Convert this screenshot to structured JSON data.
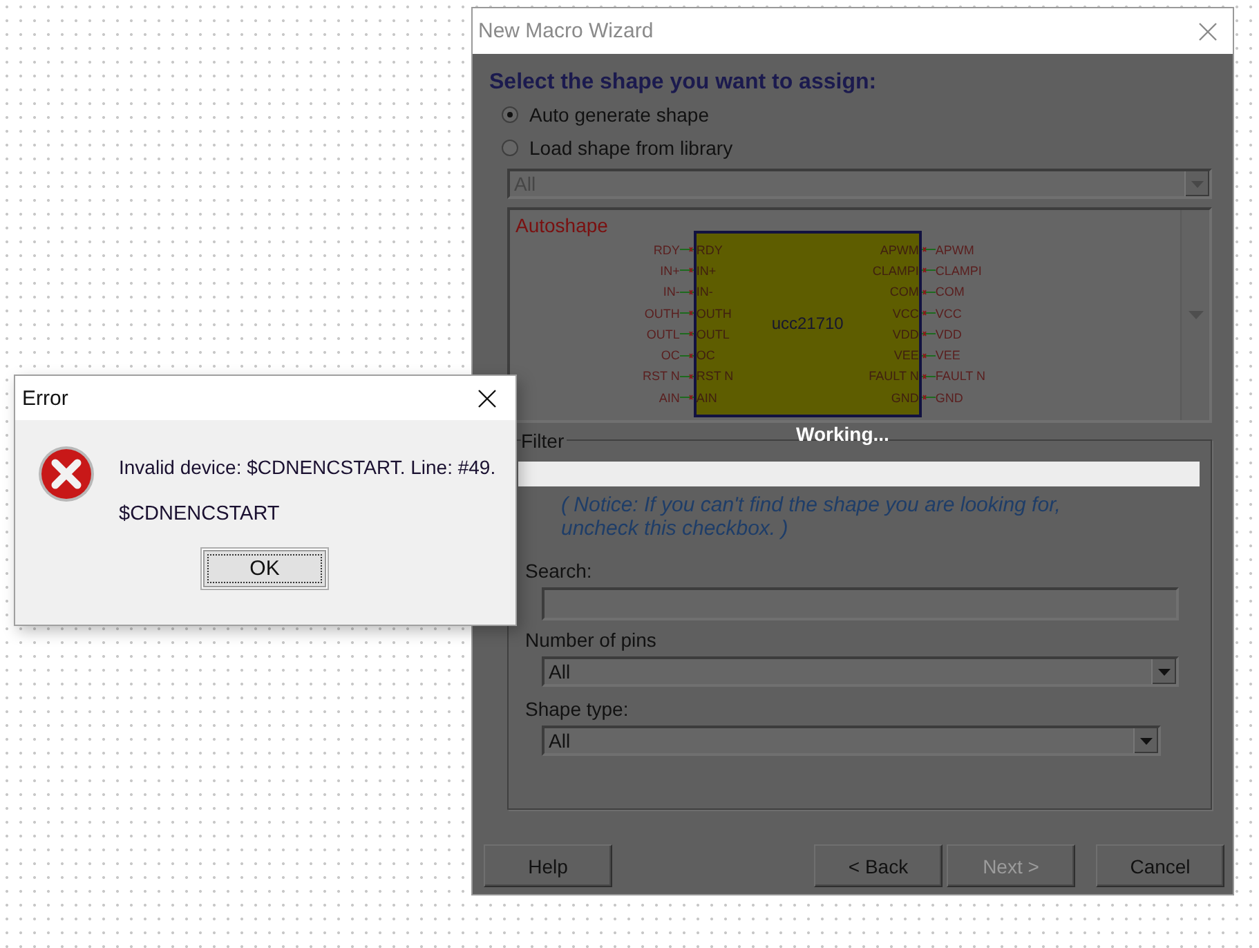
{
  "wizard": {
    "title": "New Macro Wizard",
    "heading": "Select the shape you want to assign:",
    "shape_source": [
      {
        "label": "Auto generate shape",
        "selected": true
      },
      {
        "label": "Load shape from library",
        "selected": false
      }
    ],
    "library": {
      "value": "All",
      "disabled": true
    },
    "preview": {
      "title": "Autoshape",
      "part": "ucc21710",
      "left_pins": [
        {
          "outer": "RDY",
          "inner": "RDY"
        },
        {
          "outer": "IN+",
          "inner": "IN+"
        },
        {
          "outer": "IN-",
          "inner": "IN-"
        },
        {
          "outer": "OUTH",
          "inner": "OUTH"
        },
        {
          "outer": "OUTL",
          "inner": "OUTL"
        },
        {
          "outer": "OC",
          "inner": "OC"
        },
        {
          "outer": "RST N",
          "inner": "RST N"
        },
        {
          "outer": "AIN",
          "inner": "AIN"
        }
      ],
      "right_pins": [
        {
          "inner": "APWM",
          "outer": "APWM"
        },
        {
          "inner": "CLAMPI",
          "outer": "CLAMPI"
        },
        {
          "inner": "COM",
          "outer": "COM"
        },
        {
          "inner": "VCC",
          "outer": "VCC"
        },
        {
          "inner": "VDD",
          "outer": "VDD"
        },
        {
          "inner": "VEE",
          "outer": "VEE"
        },
        {
          "inner": "FAULT N",
          "outer": "FAULT N"
        },
        {
          "inner": "GND",
          "outer": "GND"
        }
      ]
    },
    "status": "Working...",
    "filter": {
      "title": "Filter",
      "notice": "( Notice: If you can't find the shape you are looking for, uncheck this checkbox. )",
      "search": {
        "label": "Search:"
      },
      "pin_count": {
        "label": "Number of pins",
        "value": "All"
      },
      "shape_type": {
        "label": "Shape type:",
        "value": "All"
      }
    },
    "buttons": [
      {
        "label": "Help",
        "disabled": false
      },
      {
        "label": "< Back",
        "disabled": false
      },
      {
        "label": "Next >",
        "disabled": true
      },
      {
        "label": "Cancel",
        "disabled": false
      }
    ]
  },
  "error_dialog": {
    "title": "Error",
    "message": "Invalid device: $CDNENCSTART. Line: #49.",
    "detail": "$CDNENCSTART",
    "button": "OK"
  }
}
